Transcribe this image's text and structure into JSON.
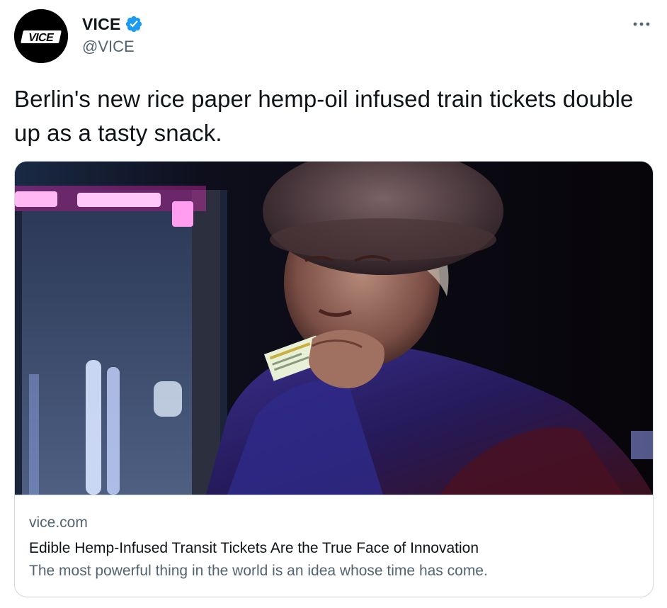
{
  "author": {
    "display_name": "VICE",
    "handle": "@VICE",
    "avatar_logo_text": "VICE",
    "verified": true,
    "avatar_icon": "vice-logo",
    "verified_icon": "verified-badge-icon"
  },
  "menu": {
    "icon": "more-horizontal-icon"
  },
  "tweet": {
    "text": "Berlin's new rice paper hemp-oil infused train tickets double up as a tasty snack."
  },
  "card": {
    "domain": "vice.com",
    "title": "Edible Hemp-Infused Transit Tickets Are the True Face of Innovation",
    "description": "The most powerful thing in the world is an idea whose time has come.",
    "image_icon": "link-preview-image"
  },
  "colors": {
    "text_primary": "#0f1419",
    "text_secondary": "#536471",
    "verified_blue": "#1d9bf0",
    "border": "#cfd9de"
  }
}
